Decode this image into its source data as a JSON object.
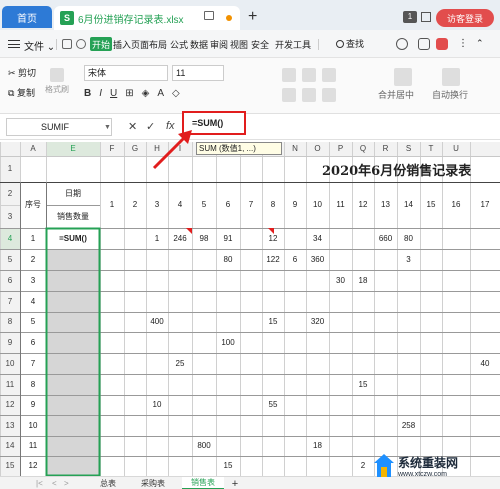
{
  "titlebar": {
    "home_tab": "首页",
    "file_tab": "6月份进销存记录表.xlsx",
    "file_icon": "S",
    "badge": "1",
    "login": "访客登录",
    "accent": "#2d7ad6",
    "green": "#25a155"
  },
  "menu": {
    "file": "文件",
    "start": "开始",
    "items": [
      "插入",
      "页面布局",
      "公式",
      "数据",
      "审阅",
      "视图",
      "安全",
      "开发工具"
    ],
    "search": "查找"
  },
  "ribbon": {
    "cut": "剪切",
    "copy": "复制",
    "format_painter": "格式刷",
    "font": "宋体",
    "size": "11",
    "bold": "B",
    "italic": "I",
    "underline": "U",
    "merge": "合并居中",
    "wrap": "自动换行"
  },
  "formula_bar": {
    "name_box": "SUMIF",
    "cancel": "✕",
    "confirm": "✓",
    "fx": "fx",
    "formula": "=SUM()",
    "tooltip": "SUM (数值1, ...)"
  },
  "sheet": {
    "columns": [
      "A",
      "E",
      "F",
      "G",
      "H",
      "I",
      "J",
      "K",
      "L",
      "M",
      "N",
      "O",
      "P",
      "Q",
      "R",
      "S",
      "T",
      "U"
    ],
    "rows": [
      "1",
      "2",
      "3",
      "4",
      "5",
      "6",
      "7",
      "8",
      "9",
      "10",
      "11",
      "12",
      "13",
      "14",
      "15"
    ],
    "title": "2020年6月份销售记录表",
    "header_seq": "序号",
    "header_date": "日期",
    "header_qty": "销售数量",
    "day_headers": [
      "1",
      "2",
      "3",
      "4",
      "5",
      "6",
      "7",
      "8",
      "9",
      "10",
      "11",
      "12",
      "13",
      "14",
      "15",
      "16",
      "17"
    ],
    "data_rows": [
      {
        "seq": "1",
        "total": "=SUM()",
        "vals": [
          "",
          "",
          "1",
          "246",
          "98",
          "91",
          "",
          "12",
          "",
          "34",
          "",
          "",
          "660",
          "80",
          "",
          "",
          ""
        ]
      },
      {
        "seq": "2",
        "total": "",
        "vals": [
          "",
          "",
          "",
          "",
          "",
          "80",
          "",
          "122",
          "6",
          "360",
          "",
          "",
          "",
          "3",
          "",
          "",
          ""
        ]
      },
      {
        "seq": "3",
        "total": "",
        "vals": [
          "",
          "",
          "",
          "",
          "",
          "",
          "",
          "",
          "",
          "",
          "30",
          "18",
          "",
          "",
          "",
          "",
          ""
        ]
      },
      {
        "seq": "4",
        "total": "",
        "vals": [
          "",
          "",
          "",
          "",
          "",
          "",
          "",
          "",
          "",
          "",
          "",
          "",
          "",
          "",
          "",
          "",
          ""
        ]
      },
      {
        "seq": "5",
        "total": "",
        "vals": [
          "",
          "",
          "400",
          "",
          "",
          "",
          "",
          "15",
          "",
          "320",
          "",
          "",
          "",
          "",
          "",
          "",
          ""
        ]
      },
      {
        "seq": "6",
        "total": "",
        "vals": [
          "",
          "",
          "",
          "",
          "",
          "100",
          "",
          "",
          "",
          "",
          "",
          "",
          "",
          "",
          "",
          "",
          ""
        ]
      },
      {
        "seq": "7",
        "total": "",
        "vals": [
          "",
          "",
          "",
          "25",
          "",
          "",
          "",
          "",
          "",
          "",
          "",
          "",
          "",
          "",
          "",
          "",
          "40"
        ]
      },
      {
        "seq": "8",
        "total": "",
        "vals": [
          "",
          "",
          "",
          "",
          "",
          "",
          "",
          "",
          "",
          "",
          "",
          "15",
          "",
          "",
          "",
          "",
          ""
        ]
      },
      {
        "seq": "9",
        "total": "",
        "vals": [
          "",
          "",
          "10",
          "",
          "",
          "",
          "",
          "55",
          "",
          "",
          "",
          "",
          "",
          "",
          "",
          "",
          ""
        ]
      },
      {
        "seq": "10",
        "total": "",
        "vals": [
          "",
          "",
          "",
          "",
          "",
          "",
          "",
          "",
          "",
          "",
          "",
          "",
          "",
          "258",
          "",
          "",
          ""
        ]
      },
      {
        "seq": "11",
        "total": "",
        "vals": [
          "",
          "",
          "",
          "",
          "800",
          "",
          "",
          "",
          "",
          "18",
          "",
          "",
          "",
          "",
          "",
          "",
          ""
        ]
      },
      {
        "seq": "12",
        "total": "",
        "vals": [
          "",
          "",
          "",
          "",
          "",
          "15",
          "",
          "",
          "",
          "",
          "",
          "2",
          "",
          "",
          "",
          "",
          ""
        ]
      }
    ]
  },
  "tabs": {
    "items": [
      "总表",
      "采购表",
      "销售表"
    ],
    "active": "销售表",
    "add": "+"
  },
  "watermark": {
    "line1": "系统重装网",
    "line2": "www.xtczw.com"
  }
}
